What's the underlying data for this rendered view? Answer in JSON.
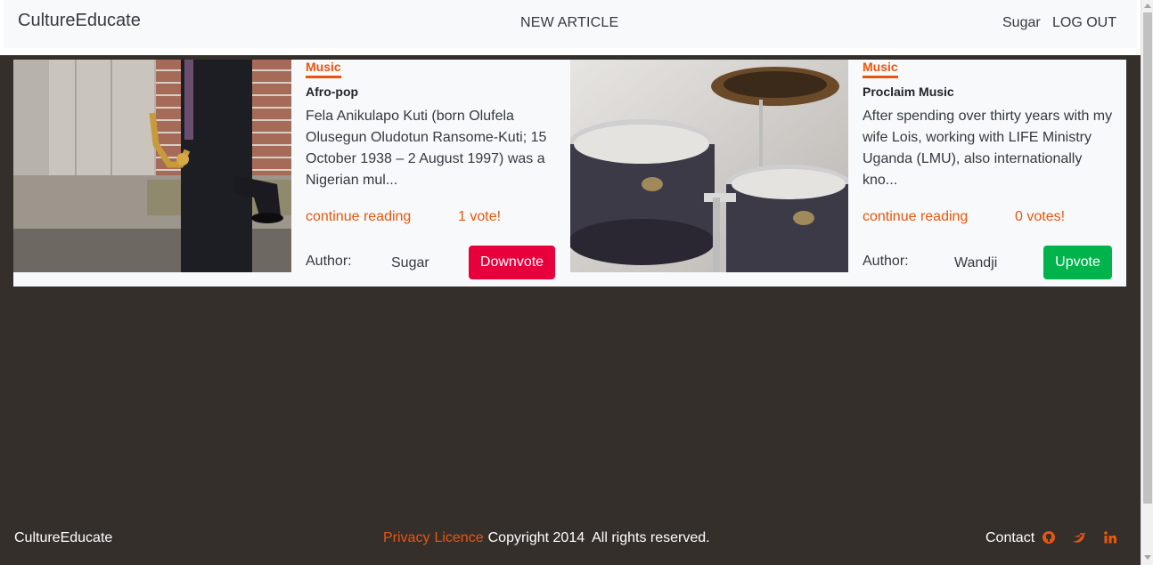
{
  "header": {
    "brand": "CultureEducate",
    "new_article": "NEW ARTICLE",
    "username": "Sugar",
    "logout": "LOG OUT"
  },
  "articles": [
    {
      "category": "Music",
      "title": "Afro-pop",
      "excerpt": "Fela Anikulapo Kuti (born Olufela Olusegun Oludotun Ransome-Kuti; 15 October 1938 – 2 August 1997) was a Nigerian mul...",
      "continue_label": "continue reading",
      "votes": "1 vote!",
      "author_label": "Author:",
      "author": "Sugar",
      "action_label": "Downvote",
      "action_color": "#e8003d",
      "image": "saxophone-player-photo"
    },
    {
      "category": "Music",
      "title": "Proclaim Music",
      "excerpt": "After spending over thirty years with my wife Lois, working with LIFE Ministry Uganda (LMU), also internationally kno...",
      "continue_label": "continue reading",
      "votes": "0 votes!",
      "author_label": "Author:",
      "author": "Wandji",
      "action_label": "Upvote",
      "action_color": "#00b34a",
      "image": "drum-kit-photo"
    }
  ],
  "footer": {
    "brand": "CultureEducate",
    "privacy": "Privacy",
    "licence": "Licence",
    "copyright": "Copyright 2014",
    "rights": "All rights reserved.",
    "contact": "Contact",
    "social_icons": [
      "github-icon",
      "twitter-icon",
      "linkedin-icon"
    ]
  },
  "colors": {
    "accent": "#e8560e",
    "background": "#352f2c",
    "downvote": "#e8003d",
    "upvote": "#00b34a"
  }
}
